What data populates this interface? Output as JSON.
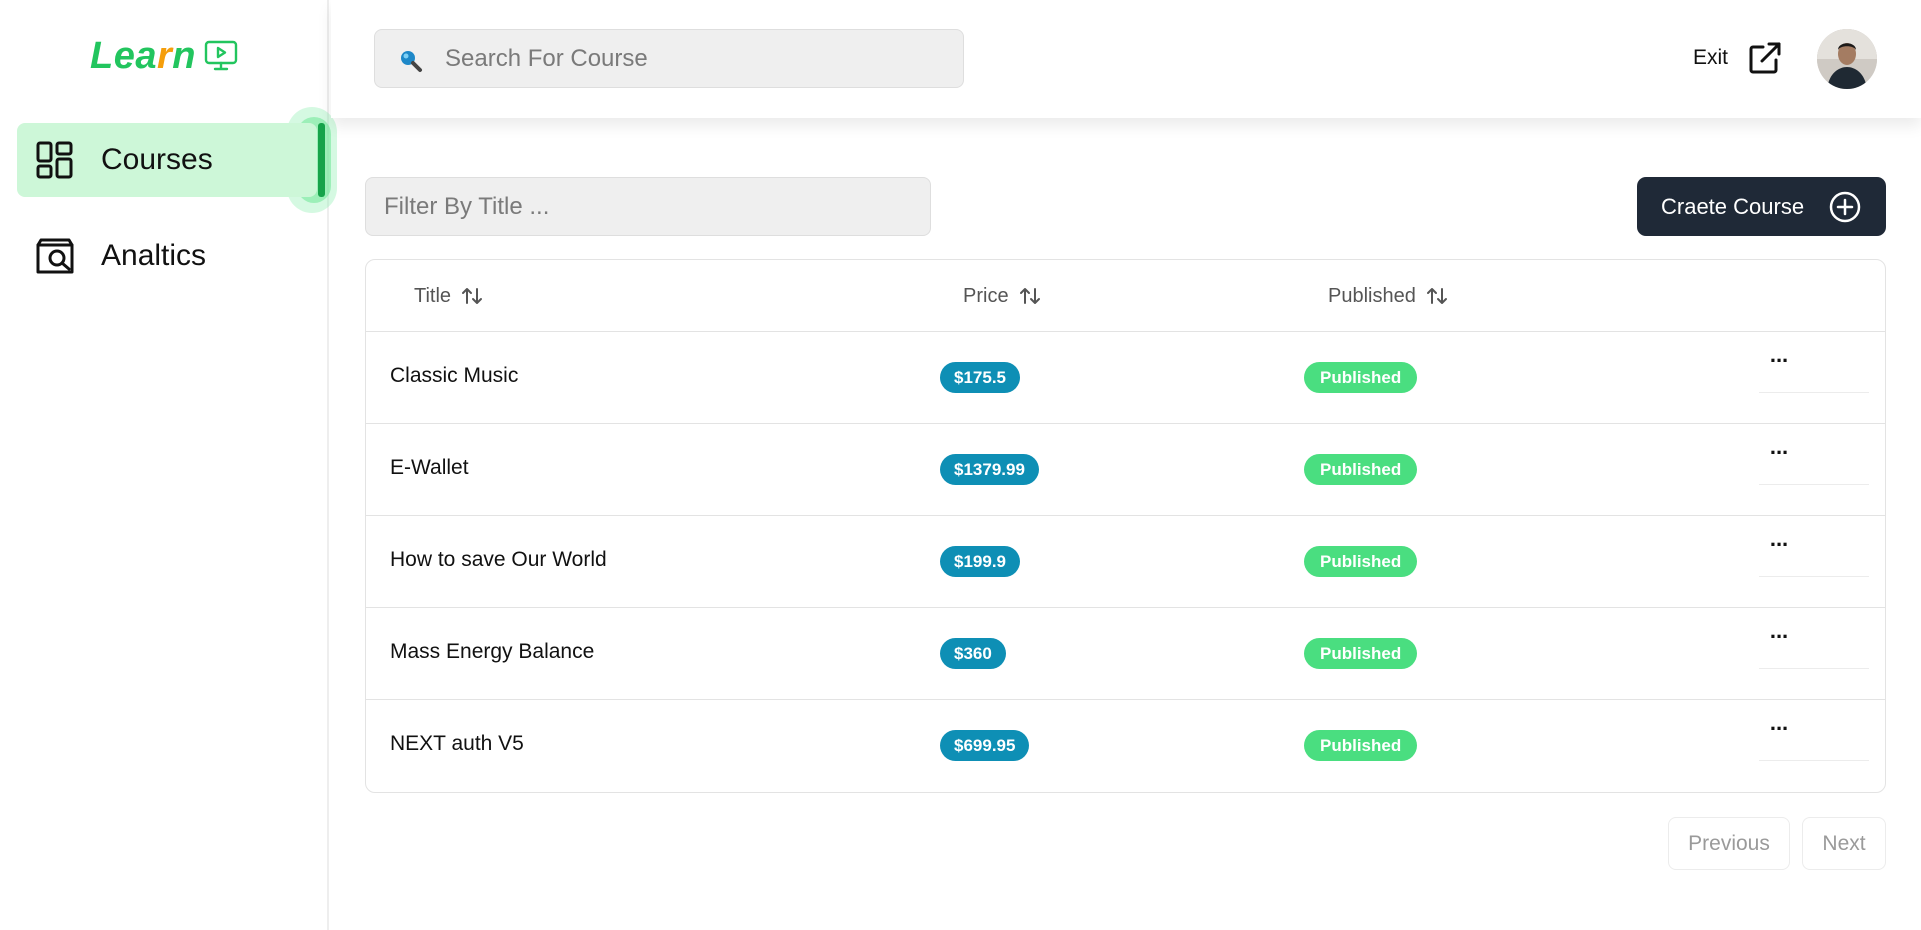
{
  "logo": {
    "text_part1": "Lea",
    "text_part2": "r",
    "text_part3": "n"
  },
  "sidebar": {
    "items": [
      {
        "label": "Courses",
        "icon": "dashboard-icon",
        "active": true
      },
      {
        "label": "Analtics",
        "icon": "analytics-icon",
        "active": false
      }
    ]
  },
  "header": {
    "search_placeholder": "Search For Course",
    "exit_label": "Exit"
  },
  "toolbar": {
    "filter_placeholder": "Filter By Title ...",
    "create_label": "Craete Course"
  },
  "table": {
    "columns": [
      "Title",
      "Price",
      "Published"
    ],
    "rows": [
      {
        "title": "Classic Music",
        "price": "$175.5",
        "status": "Published"
      },
      {
        "title": "E-Wallet",
        "price": "$1379.99",
        "status": "Published"
      },
      {
        "title": "How to save Our World",
        "price": "$199.9",
        "status": "Published"
      },
      {
        "title": "Mass Energy Balance",
        "price": "$360",
        "status": "Published"
      },
      {
        "title": "NEXT auth V5",
        "price": "$699.95",
        "status": "Published"
      }
    ],
    "more_label": "..."
  },
  "pagination": {
    "previous_label": "Previous",
    "next_label": "Next"
  },
  "colors": {
    "brand_green": "#22c55e",
    "brand_orange": "#f59e0b",
    "active_nav_bg": "#cdf7d8",
    "price_badge": "#0e8fb5",
    "published_badge": "#4ade80",
    "primary_button": "#1f2937"
  }
}
